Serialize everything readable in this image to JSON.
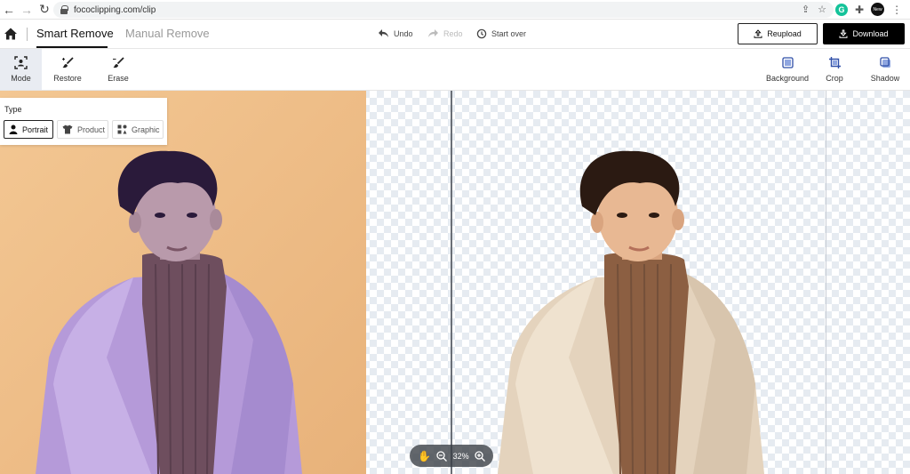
{
  "browser": {
    "url": "fococlipping.com/clip",
    "avatar_label": "New"
  },
  "header": {
    "tabs": [
      {
        "label": "Smart Remove",
        "active": true
      },
      {
        "label": "Manual Remove",
        "active": false
      }
    ],
    "undo_label": "Undo",
    "redo_label": "Redo",
    "start_over_label": "Start over",
    "reupload_label": "Reupload",
    "download_label": "Download"
  },
  "toolbar": {
    "left_tools": [
      {
        "label": "Mode",
        "icon": "mode-icon",
        "active": true
      },
      {
        "label": "Restore",
        "icon": "restore-brush-icon",
        "active": false
      },
      {
        "label": "Erase",
        "icon": "erase-brush-icon",
        "active": false
      }
    ],
    "right_tools": [
      {
        "label": "Background",
        "icon": "background-icon"
      },
      {
        "label": "Crop",
        "icon": "crop-icon"
      },
      {
        "label": "Shadow",
        "icon": "shadow-icon"
      }
    ]
  },
  "type_panel": {
    "title": "Type",
    "options": [
      {
        "label": "Portrait",
        "icon": "portrait-icon",
        "selected": true
      },
      {
        "label": "Product",
        "icon": "product-shirt-icon",
        "selected": false
      },
      {
        "label": "Graphic",
        "icon": "graphic-shapes-icon",
        "selected": false
      }
    ]
  },
  "zoom": {
    "level": "32%"
  },
  "colors": {
    "original_background": "#efbf88",
    "accent_dark": "#000000",
    "active_tool_bg": "#e9ecf2"
  }
}
